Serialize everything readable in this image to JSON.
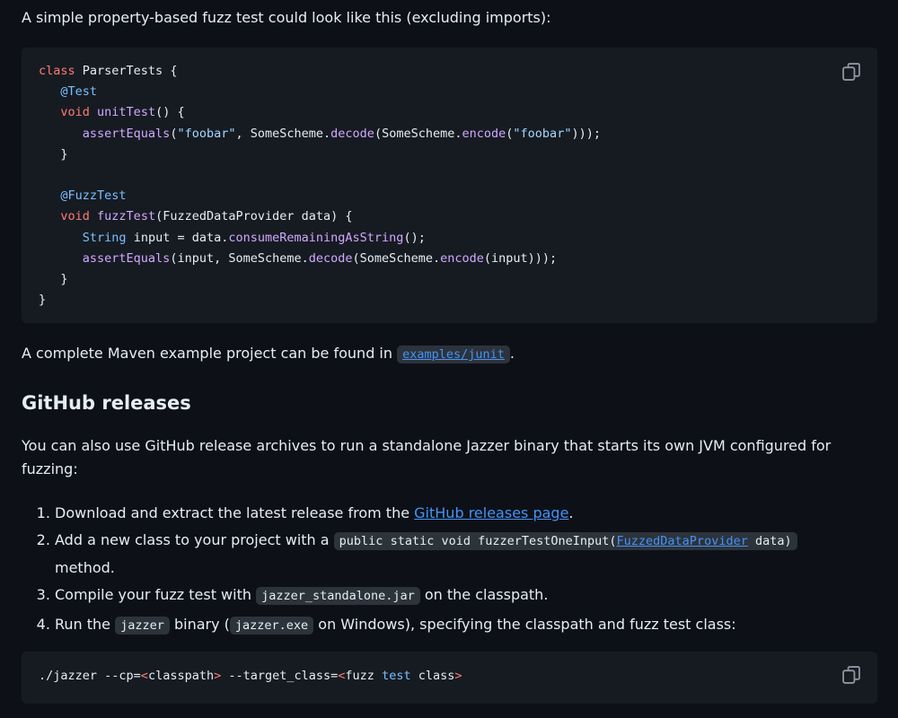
{
  "intro": {
    "text": "A simple property-based fuzz test could look like this (excluding imports):"
  },
  "code_block_1": {
    "copy_icon": "copy-icon",
    "lines": [
      "class ParserTests {",
      "   @Test",
      "   void unitTest() {",
      "      assertEquals(\"foobar\", SomeScheme.decode(SomeScheme.encode(\"foobar\")));",
      "   }",
      "",
      "   @FuzzTest",
      "   void fuzzTest(FuzzedDataProvider data) {",
      "      String input = data.consumeRemainingAsString();",
      "      assertEquals(input, SomeScheme.decode(SomeScheme.encode(input)));",
      "   }",
      "}"
    ]
  },
  "maven_note": {
    "before": "A complete Maven example project can be found in ",
    "link_code": "examples/junit",
    "after": "."
  },
  "section": {
    "title": "GitHub releases",
    "description_line1": "You can also use GitHub release archives to run a standalone Jazzer binary that starts its own JVM configured for",
    "description_line2": "fuzzing:"
  },
  "steps": [
    {
      "before": "Download and extract the latest release from the ",
      "link": "GitHub releases page",
      "after": "."
    },
    {
      "before": "Add a new class to your project with a ",
      "code_before": "public static void fuzzerTestOneInput(",
      "code_link": "FuzzedDataProvider",
      "code_after": " data)",
      "after_line2": "method."
    },
    {
      "before": "Compile your fuzz test with ",
      "code": "jazzer_standalone.jar",
      "after": " on the classpath."
    },
    {
      "before": "Run the ",
      "code1": "jazzer",
      "middle": " binary (",
      "code2": "jazzer.exe",
      "after": " on Windows), specifying the classpath and fuzz test class:"
    }
  ],
  "code_block_2": {
    "copy_icon": "copy-icon",
    "command": "./jazzer --cp=<classpath> --target_class=<fuzz test class>"
  }
}
